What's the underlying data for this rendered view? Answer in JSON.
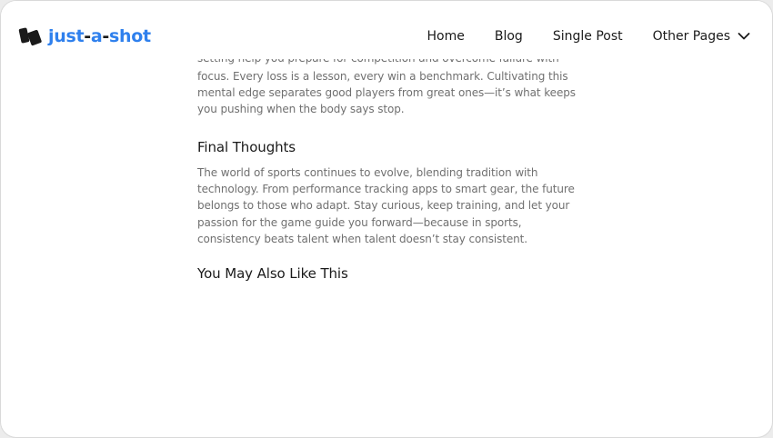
{
  "brand": {
    "name_part1": "just",
    "dash1": "-",
    "name_part2": "a",
    "dash2": "-",
    "name_part3": "shot"
  },
  "nav": {
    "items": [
      {
        "label": "Home"
      },
      {
        "label": "Blog"
      },
      {
        "label": "Single Post"
      },
      {
        "label": "Other Pages"
      }
    ]
  },
  "article": {
    "cut_line": "setting help you prepare for competition and overcome failure with",
    "para1_lines": [
      "focus. Every loss is a lesson, every win a benchmark. Cultivating this",
      "mental edge separates good players from great ones—it’s what keeps",
      "you pushing when the body says stop."
    ],
    "final_heading": "Final Thoughts",
    "para2_lines": [
      "The world of sports continues to evolve, blending tradition with",
      "technology. From performance tracking apps to smart gear, the future",
      "belongs to those who adapt. Stay curious, keep training, and let your",
      "passion for the game guide you forward—because in sports,",
      "consistency beats talent when talent doesn’t stay consistent."
    ],
    "related_heading": "You May Also Like This"
  }
}
